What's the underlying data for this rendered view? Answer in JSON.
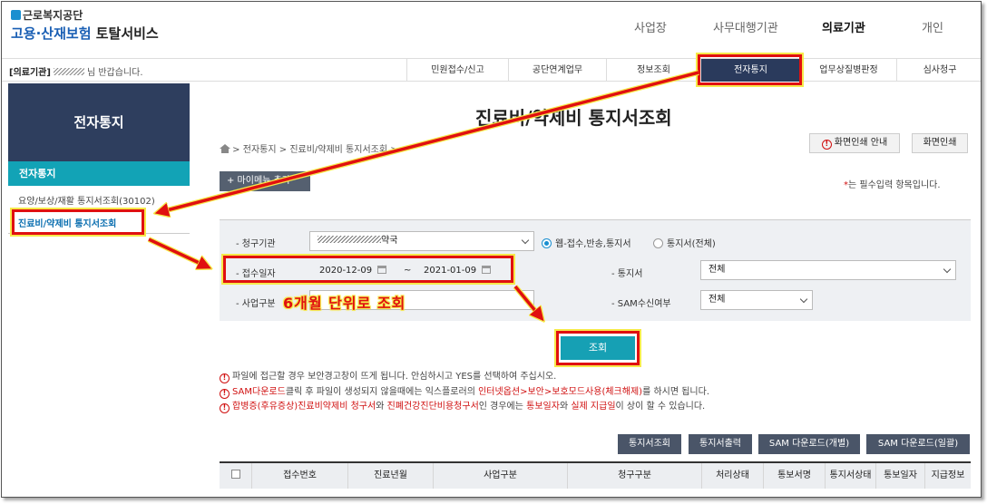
{
  "header": {
    "org_name": "근로복지공단",
    "service_name_part1": "고용·산재보험",
    "service_name_part2": "토탈서비스",
    "top_nav": [
      "사업장",
      "사무대행기관",
      "의료기관",
      "개인"
    ],
    "top_nav_active": "의료기관"
  },
  "subbar": {
    "welcome_prefix": "[의료기관]",
    "welcome_suffix": "님 반갑습니다.",
    "tabs": [
      "민원접수/신고",
      "공단연계업무",
      "정보조회",
      "전자통지",
      "업무상질병판정",
      "심사청구"
    ],
    "active_tab": "전자통지"
  },
  "sidebar": {
    "title": "전자통지",
    "section": "전자통지",
    "items": [
      "요양/보상/재활 통지서조회(30102)",
      "진료비/약제비 통지서조회"
    ]
  },
  "main": {
    "title": "진료비/약제비 통지서조회",
    "breadcrumb": [
      "전자통지",
      "진료비/약제비 통지서조회"
    ],
    "print_guide": "화면인쇄 안내",
    "print": "화면인쇄",
    "favorite": "+ 마이메뉴 추가",
    "required_star": "*",
    "required_note": "는 필수입력 항목입니다."
  },
  "search": {
    "institution_label": "청구기관",
    "institution_suffix": "약국",
    "radio_web": "웹-접수,반송,통지서",
    "radio_all": "통지서(전체)",
    "date_label": "접수일자",
    "date_from": "2020-12-09",
    "date_sep": "~",
    "date_to": "2021-01-09",
    "notice_label": "통지서",
    "notice_value": "전체",
    "biz_label": "사업구분",
    "sam_label": "SAM수신여부",
    "sam_value": "전체",
    "search_button": "조회"
  },
  "annotation": "6개월 단위로 조회",
  "notices": [
    {
      "text1": "파일에 접근할 경우 보안경고창이 뜨게 됩니다. 안심하시고 YES를 선택하여 주십시오.",
      "red1": "",
      "text2": "",
      "red2": "",
      "text3": ""
    },
    {
      "text1": "",
      "red1": "SAM다운로드",
      "text2": "클릭 후 파일이 생성되지 않을때에는 익스플로러의 ",
      "red2": "인터넷옵션>보안>보호모드사용(체크해제)",
      "text3": "를 하시면 됩니다."
    },
    {
      "text1": "",
      "red1": "합병증(후유증상)진료비약제비 청구서",
      "text2": "와 ",
      "red2": "진폐건강진단비용청구서",
      "text3": "인 경우에는 ",
      "red3": "통보일자",
      "text4": "와 ",
      "red4": "실제 지급일",
      "text5": "이 상이 할 수 있습니다."
    }
  ],
  "actions": [
    "통지서조회",
    "통지서출력",
    "SAM 다운로드(개별)",
    "SAM 다운로드(일괄)"
  ],
  "table": {
    "headers": [
      "접수번호",
      "진료년월",
      "사업구분",
      "청구구분",
      "처리상태",
      "통보서명",
      "통지서상태",
      "통보일자",
      "지급정보"
    ]
  },
  "colors": {
    "accent": "#12a3b6",
    "nav_dark": "#2e3e5e",
    "highlight": "#e01010",
    "highlight_outline": "#f6e94a"
  }
}
